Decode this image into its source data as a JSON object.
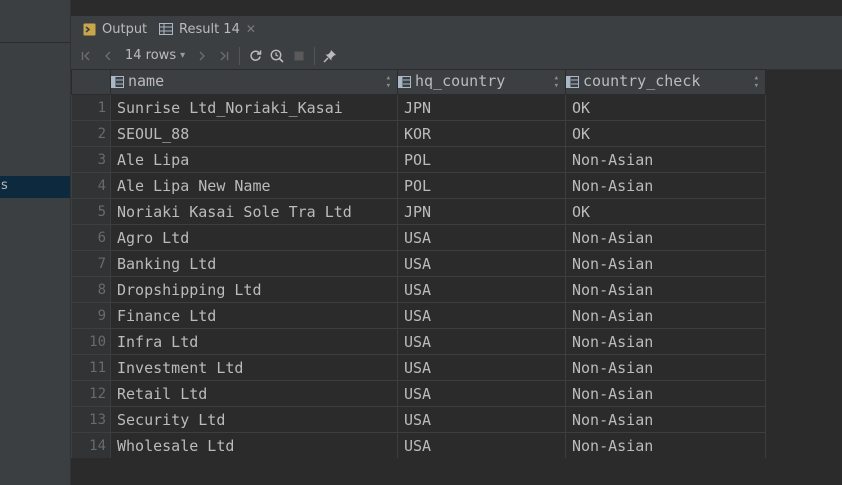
{
  "tabs": [
    {
      "label": "Output"
    },
    {
      "label": "Result 14"
    }
  ],
  "toolbar": {
    "rows_label": "14 rows"
  },
  "sidebar": {
    "selected_item_text": "s"
  },
  "table": {
    "columns": [
      "name",
      "hq_country",
      "country_check"
    ],
    "rows": [
      {
        "num": "1",
        "name": "Sunrise Ltd_Noriaki_Kasai",
        "hq_country": "JPN",
        "country_check": "OK"
      },
      {
        "num": "2",
        "name": "SEOUL_88",
        "hq_country": "KOR",
        "country_check": "OK"
      },
      {
        "num": "3",
        "name": "Ale Lipa",
        "hq_country": "POL",
        "country_check": "Non-Asian"
      },
      {
        "num": "4",
        "name": "Ale Lipa New Name",
        "hq_country": "POL",
        "country_check": "Non-Asian"
      },
      {
        "num": "5",
        "name": "Noriaki Kasai Sole Tra Ltd",
        "hq_country": "JPN",
        "country_check": "OK"
      },
      {
        "num": "6",
        "name": "Agro Ltd",
        "hq_country": "USA",
        "country_check": "Non-Asian"
      },
      {
        "num": "7",
        "name": "Banking Ltd",
        "hq_country": "USA",
        "country_check": "Non-Asian"
      },
      {
        "num": "8",
        "name": "Dropshipping Ltd",
        "hq_country": "USA",
        "country_check": "Non-Asian"
      },
      {
        "num": "9",
        "name": "Finance Ltd",
        "hq_country": "USA",
        "country_check": "Non-Asian"
      },
      {
        "num": "10",
        "name": "Infra Ltd",
        "hq_country": "USA",
        "country_check": "Non-Asian"
      },
      {
        "num": "11",
        "name": "Investment Ltd",
        "hq_country": "USA",
        "country_check": "Non-Asian"
      },
      {
        "num": "12",
        "name": "Retail Ltd",
        "hq_country": "USA",
        "country_check": "Non-Asian"
      },
      {
        "num": "13",
        "name": "Security Ltd",
        "hq_country": "USA",
        "country_check": "Non-Asian"
      },
      {
        "num": "14",
        "name": "Wholesale Ltd",
        "hq_country": "USA",
        "country_check": "Non-Asian"
      }
    ]
  }
}
